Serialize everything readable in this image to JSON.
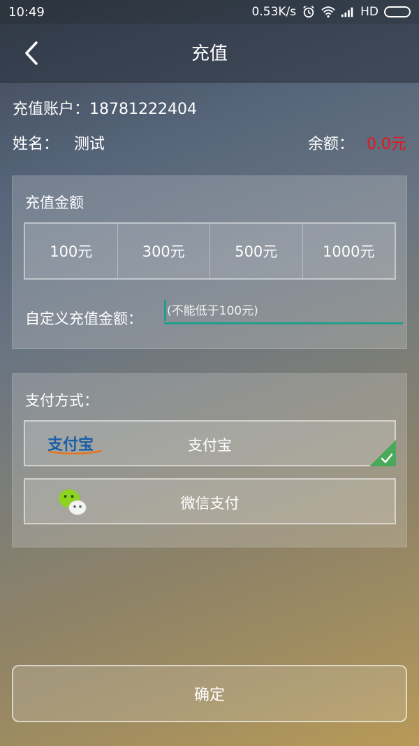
{
  "status_bar": {
    "time": "10:49",
    "network_speed": "0.53K/s",
    "network_type": "HD",
    "icons": [
      "alarm-icon",
      "wifi-icon",
      "signal-icon",
      "battery-icon"
    ]
  },
  "header": {
    "title": "充值",
    "back_icon": "chevron-left-icon"
  },
  "account": {
    "label": "充值账户：",
    "number": "18781222404",
    "name_label": "姓名：",
    "name_value": "测试",
    "balance_label": "余额：",
    "balance_value": "0.0元",
    "balance_color": "#e8141b"
  },
  "recharge": {
    "label": "充值金额",
    "options": [
      "100元",
      "300元",
      "500元",
      "1000元"
    ],
    "custom_label": "自定义充值金额：",
    "custom_placeholder": "(不能低于100元)",
    "custom_value": "",
    "accent_color": "#1f9e8c"
  },
  "payment": {
    "label": "支付方式：",
    "methods": [
      {
        "label": "支付宝",
        "icon": "alipay-logo-icon",
        "logo_text": "支付宝",
        "selected": true
      },
      {
        "label": "微信支付",
        "icon": "wechat-logo-icon",
        "selected": false
      }
    ],
    "selected_color": "#4aa85a"
  },
  "confirm_label": "确定"
}
